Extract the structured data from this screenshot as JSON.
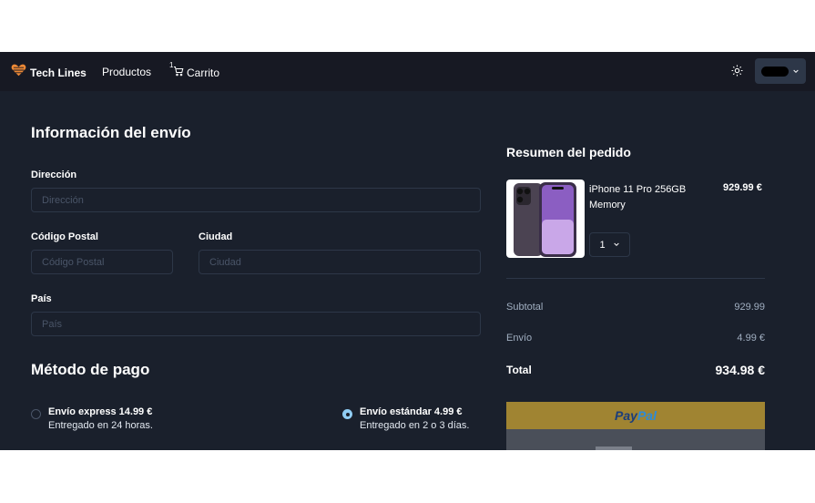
{
  "nav": {
    "brand": "Tech Lines",
    "links": {
      "products": "Productos",
      "cart": "Carrito"
    },
    "cart_count": "1",
    "icons": {
      "logo": "heart-icon",
      "cart": "cart-icon",
      "theme": "sun-icon",
      "chevron": "chevron-down-icon"
    },
    "brand_color": "#ed8936"
  },
  "shipping": {
    "title": "Información del envío",
    "address": {
      "label": "Dirección",
      "placeholder": "Dirección",
      "value": ""
    },
    "postal": {
      "label": "Código Postal",
      "placeholder": "Código Postal",
      "value": ""
    },
    "city": {
      "label": "Ciudad",
      "placeholder": "Ciudad",
      "value": ""
    },
    "country": {
      "label": "País",
      "placeholder": "País",
      "value": ""
    }
  },
  "payment": {
    "title": "Método de pago",
    "options": [
      {
        "title": "Envío express 14.99 €",
        "subtitle": "Entregado en 24 horas.",
        "selected": false
      },
      {
        "title": "Envío estándar 4.99 €",
        "subtitle": "Entregado en 2 o 3 días.",
        "selected": true
      }
    ]
  },
  "summary": {
    "title": "Resumen del pedido",
    "item": {
      "name": "iPhone 11 Pro 256GB Memory",
      "price": "929.99 €",
      "quantity": "1"
    },
    "subtotal_label": "Subtotal",
    "subtotal_value": "929.99",
    "shipping_label": "Envío",
    "shipping_value": "4.99 €",
    "total_label": "Total",
    "total_value": "934.98 €"
  },
  "paypal": {
    "label_pay": "Pay",
    "label_pal": "Pal",
    "color_pay": "#1a3d7c",
    "color_pal": "#2c8bd8"
  }
}
